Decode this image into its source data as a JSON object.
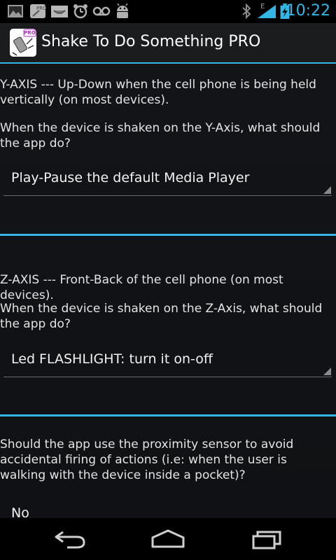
{
  "status_bar": {
    "time": "10:22",
    "icons": [
      "image-icon",
      "pro-app-icon",
      "tray-icon",
      "alarm-icon",
      "voicemail-icon",
      "android-icon",
      "bluetooth-icon",
      "signal-icon",
      "battery-icon"
    ],
    "network_label": "E"
  },
  "action_bar": {
    "title": "Shake To Do Something PRO",
    "icon_badge": "PRO"
  },
  "sections": [
    {
      "axis_text": "Y-AXIS --- Up-Down when the cell phone is being held vertically (on most devices).",
      "question": "When the device is shaken on the Y-Axis, what should the app do?",
      "selected": "Play-Pause the default Media Player"
    },
    {
      "axis_text": "Z-AXIS --- Front-Back of the cell phone (on most devices).",
      "question": "When the device is shaken on the Z-Axis, what should the app do?",
      "selected": "Led FLASHLIGHT: turn it on-off"
    },
    {
      "axis_text": "",
      "question": "Should the app use the proximity sensor to avoid accidental firing of actions (i.e: when the user is walking with the device inside a pocket)?",
      "selected": "No"
    }
  ],
  "nav_bar": {
    "buttons": [
      "back-icon",
      "home-icon",
      "recents-icon"
    ]
  },
  "colors": {
    "accent": "#33b5e5",
    "background": "#121418",
    "text": "#e4e4e4"
  }
}
